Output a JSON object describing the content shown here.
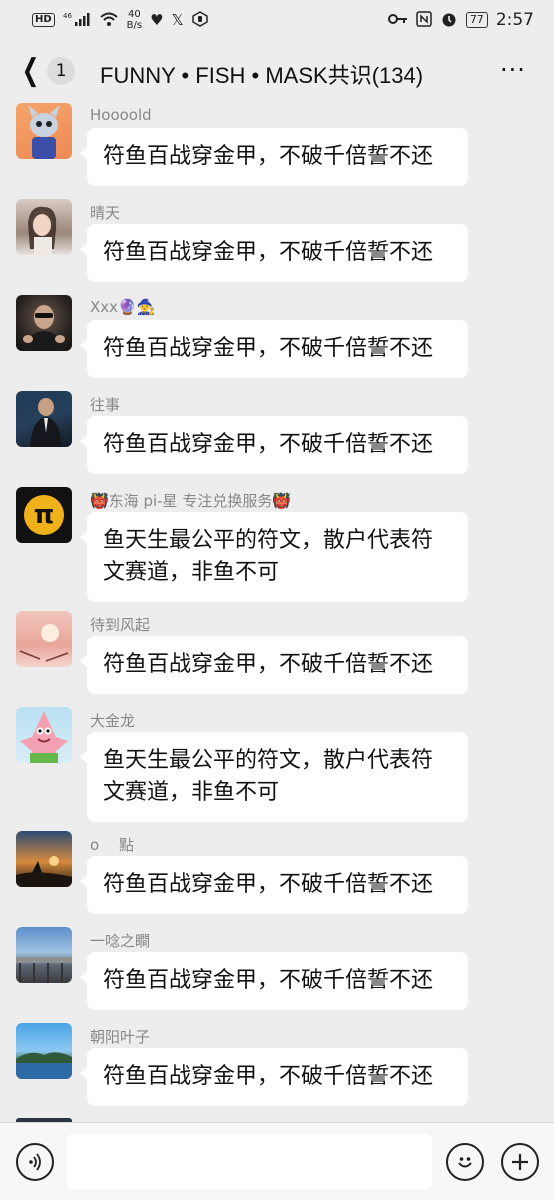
{
  "status_bar": {
    "hd": "HD",
    "signal": "46",
    "net_speed_value": "40",
    "net_speed_unit": "B/s",
    "battery": "77",
    "time": "2:57"
  },
  "header": {
    "unread_count": "1",
    "title": "FUNNY • FISH • MASK共识(134)",
    "more": "···"
  },
  "messages": [
    {
      "sender": "Hoooold",
      "text": "符鱼百战穿金甲，不破千倍誓不还"
    },
    {
      "sender": "晴天",
      "text": "符鱼百战穿金甲，不破千倍誓不还"
    },
    {
      "sender": "Xxx🔮🧙",
      "text": "符鱼百战穿金甲，不破千倍誓不还"
    },
    {
      "sender": "往事",
      "text": "符鱼百战穿金甲，不破千倍誓不还"
    },
    {
      "sender": "👹东海 pi-星 专注兑换服务👹",
      "text": "鱼天生最公平的符文，散户代表符文赛道，非鱼不可"
    },
    {
      "sender": "待到风起",
      "text": "符鱼百战穿金甲，不破千倍誓不还"
    },
    {
      "sender": "大金龙",
      "text": "鱼天生最公平的符文，散户代表符文赛道，非鱼不可"
    },
    {
      "sender": "o　 點",
      "text": "符鱼百战穿金甲，不破千倍誓不还"
    },
    {
      "sender": "一唸之瞷",
      "text": "符鱼百战穿金甲，不破千倍誓不还"
    },
    {
      "sender": "朝阳叶子",
      "text": "符鱼百战穿金甲，不破千倍誓不还"
    }
  ],
  "pi_symbol": "π",
  "bottom_bar": {
    "voice_icon": "voice-icon",
    "emoji_icon": "emoji-icon",
    "plus_icon": "plus-icon"
  }
}
